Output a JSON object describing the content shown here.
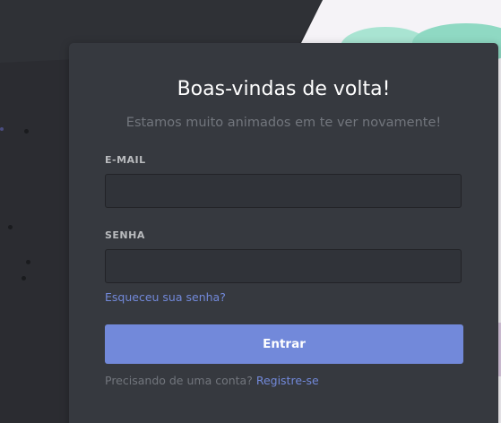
{
  "login": {
    "title": "Boas-vindas de volta!",
    "subtitle": "Estamos muito animados em te ver novamente!",
    "email_label": "E-MAIL",
    "email_value": "",
    "password_label": "SENHA",
    "password_value": "",
    "forgot_password": "Esqueceu sua senha?",
    "submit_label": "Entrar",
    "need_account": "Precisando de uma conta?",
    "register_label": "Registre-se"
  },
  "colors": {
    "background": "#2b2c31",
    "card": "#36393f",
    "input_bg": "#303339",
    "accent": "#7289da",
    "title_text": "#ffffff",
    "muted_text": "#72767d",
    "label_text": "#b9bbbe",
    "illustration_light": "#f5f3f7",
    "illustration_mint": "#8fd9c3"
  }
}
